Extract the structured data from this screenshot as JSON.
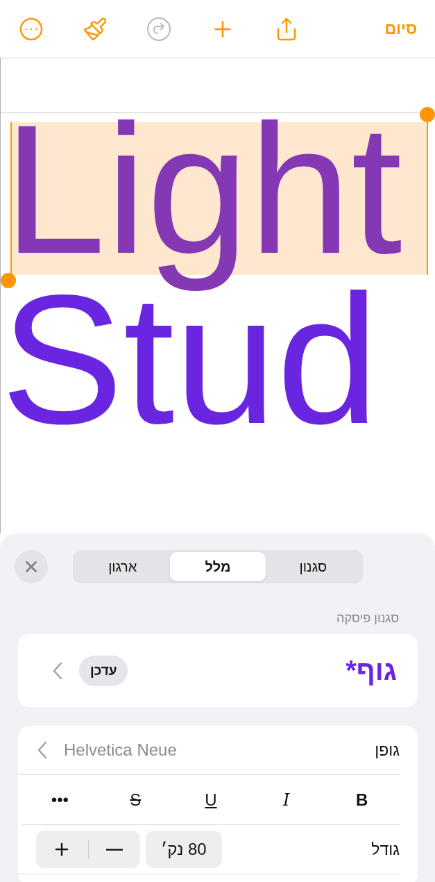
{
  "toolbar": {
    "buttons": [
      {
        "kind": "more",
        "disabled": false
      },
      {
        "kind": "brush",
        "disabled": false
      },
      {
        "kind": "redo",
        "disabled": true
      },
      {
        "kind": "add",
        "disabled": false
      },
      {
        "kind": "share",
        "disabled": false
      }
    ],
    "done": "סיום"
  },
  "document": {
    "lines": [
      {
        "text": "Light",
        "selected": true
      },
      {
        "text": "Stud",
        "selected": false
      }
    ]
  },
  "panel": {
    "tabs": [
      {
        "label": "סגנון",
        "selected": false
      },
      {
        "label": "מלל",
        "selected": true
      },
      {
        "label": "ארגון",
        "selected": false
      }
    ],
    "paragraph_style": {
      "label": "סגנון פיסקה",
      "name": "גוף*",
      "update": "עדכן"
    },
    "font": {
      "label": "גופן",
      "value": "Helvetica Neue"
    },
    "styles": [
      {
        "label": "B",
        "kind": "bold"
      },
      {
        "label": "I",
        "kind": "italic"
      },
      {
        "label": "U",
        "kind": "underline"
      },
      {
        "label": "S",
        "kind": "strike"
      },
      {
        "label": "•••",
        "kind": "more"
      }
    ],
    "size": {
      "label": "גודל",
      "value": "80 נק׳"
    }
  }
}
